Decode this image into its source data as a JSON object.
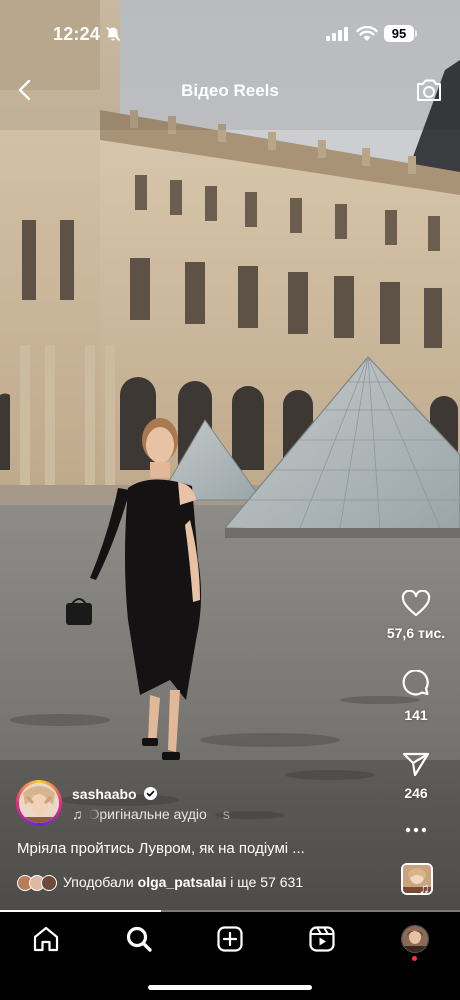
{
  "status_bar": {
    "time": "12:24",
    "battery": "95",
    "icons": [
      "bell-off-icon",
      "cellular-signal-icon",
      "wifi-icon",
      "battery-icon"
    ]
  },
  "header": {
    "title": "Відео Reels",
    "back_icon": "chevron-left-icon",
    "camera_icon": "camera-icon"
  },
  "actions": {
    "likes": "57,6 тис.",
    "comments": "141",
    "shares": "246",
    "icons": [
      "heart-icon",
      "comment-icon",
      "send-icon",
      "more-icon"
    ]
  },
  "post": {
    "username": "sashaabo",
    "audio_label": "Оригінальне аудіо",
    "audio_label_next": "s",
    "caption": "Мріяла пройтись Лувром, як на подіумі ...",
    "liked_by_prefix": "Уподобали ",
    "liked_by_user": "olga_patsalai",
    "liked_by_suffix": " і ще 57 631"
  },
  "playback": {
    "progress_fraction": 0.35
  },
  "nav": {
    "items": [
      "home-icon",
      "search-icon",
      "create-icon",
      "reels-icon",
      "profile-avatar"
    ],
    "active": "search-icon"
  },
  "colors": {
    "accent_red": "#ff3040",
    "nav_background": "#000000",
    "text": "#ffffff"
  }
}
